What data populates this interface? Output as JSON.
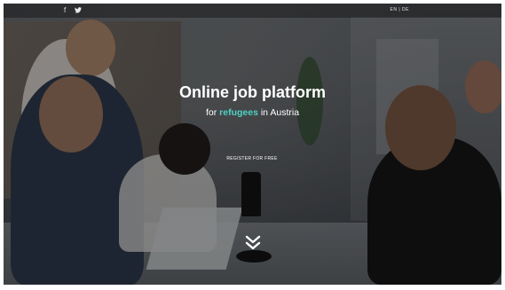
{
  "topbar": {
    "social_icons": [
      {
        "name": "facebook-icon",
        "glyph": "f"
      },
      {
        "name": "twitter-icon",
        "glyph": "🐦"
      }
    ],
    "language_switch": "EN | DE"
  },
  "hero": {
    "title": "Online job platform",
    "subtitle_prefix": "for",
    "subtitle_accent": "refugees",
    "subtitle_suffix": "in Austria",
    "register_label": "REGISTER FOR FREE",
    "scroll_icon": "double-chevron-down-icon"
  },
  "colors": {
    "accent": "#4fd1c5",
    "text": "#ffffff"
  }
}
